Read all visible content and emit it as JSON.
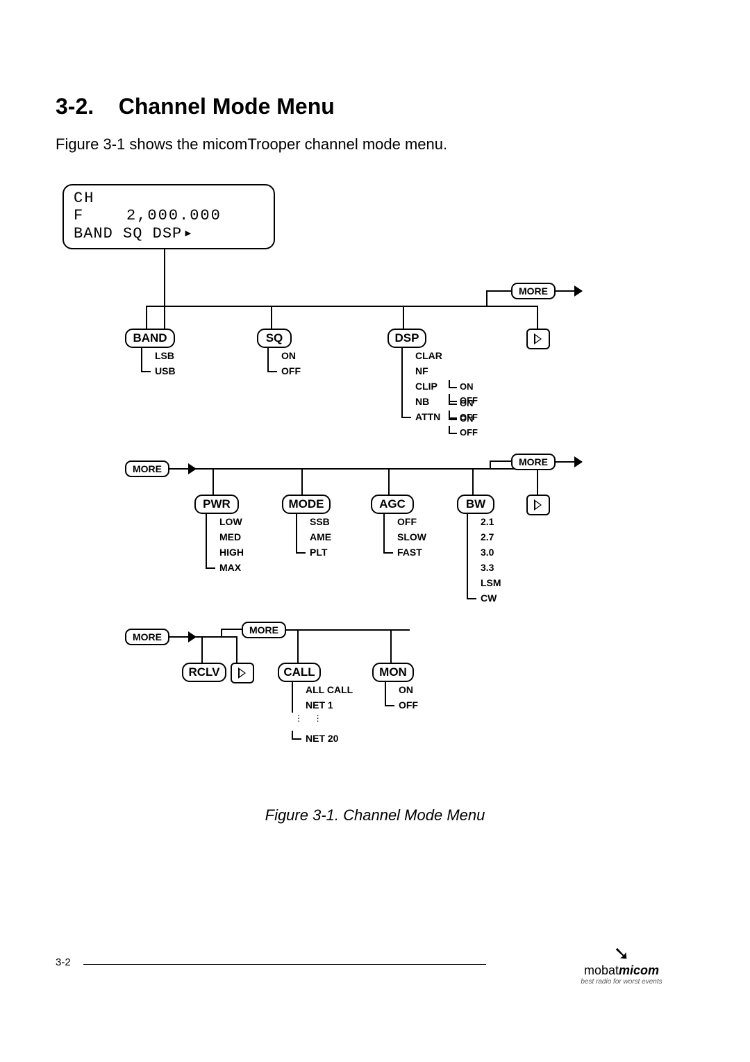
{
  "heading_num": "3-2.",
  "heading_text": "Channel Mode Menu",
  "intro": "Figure 3-1 shows the micomTrooper channel mode menu.",
  "page_number": "3-2",
  "logo": {
    "brand_left": "mobat",
    "brand_right": "micom",
    "tag": "best radio for worst events"
  },
  "caption": "Figure 3-1. Channel Mode Menu",
  "root_display": {
    "line1": "CH",
    "line2": "F    2,000.000",
    "line3": "BAND SQ  DSP"
  },
  "labels": {
    "more": "MORE",
    "band": "BAND",
    "sq": "SQ",
    "dsp": "DSP",
    "pwr": "PWR",
    "mode": "MODE",
    "agc": "AGC",
    "bw": "BW",
    "rclv": "RCLV",
    "call": "CALL",
    "mon": "MON"
  },
  "band_opts": [
    "LSB",
    "USB"
  ],
  "sq_opts": [
    "ON",
    "OFF"
  ],
  "dsp_opts": [
    "CLAR",
    "NF",
    "CLIP",
    "NB",
    "ATTN"
  ],
  "dsp_clip_opts": [
    "ON",
    "OFF"
  ],
  "dsp_nb_opts": [
    "ON",
    "OFF"
  ],
  "dsp_attn_opts": [
    "ON",
    "OFF"
  ],
  "pwr_opts": [
    "LOW",
    "MED",
    "HIGH",
    "MAX"
  ],
  "mode_opts": [
    "SSB",
    "AME",
    "PLT"
  ],
  "agc_opts": [
    "OFF",
    "SLOW",
    "FAST"
  ],
  "bw_opts": [
    "2.1",
    "2.7",
    "3.0",
    "3.3",
    "LSM",
    "CW"
  ],
  "call_opts_first": "ALL CALL",
  "call_opts_net1": "NET 1",
  "call_opts_net20": "NET 20",
  "mon_opts": [
    "ON",
    "OFF"
  ],
  "chart_data": {
    "type": "tree",
    "title": "Channel Mode Menu",
    "root": {
      "display": [
        "CH",
        "F    2,000.000",
        "BAND SQ  DSP▸"
      ],
      "children": [
        {
          "name": "BAND",
          "options": [
            "LSB",
            "USB"
          ]
        },
        {
          "name": "SQ",
          "options": [
            "ON",
            "OFF"
          ]
        },
        {
          "name": "DSP",
          "options": [
            {
              "name": "CLAR"
            },
            {
              "name": "NF"
            },
            {
              "name": "CLIP",
              "options": [
                "ON",
                "OFF"
              ]
            },
            {
              "name": "NB",
              "options": [
                "ON",
                "OFF"
              ]
            },
            {
              "name": "ATTN",
              "options": [
                "ON",
                "OFF"
              ]
            }
          ]
        },
        {
          "name": "MORE",
          "leads_to": "row2"
        }
      ]
    },
    "row2": {
      "prefix": "MORE",
      "children": [
        {
          "name": "PWR",
          "options": [
            "LOW",
            "MED",
            "HIGH",
            "MAX"
          ]
        },
        {
          "name": "MODE",
          "options": [
            "SSB",
            "AME",
            "PLT"
          ]
        },
        {
          "name": "AGC",
          "options": [
            "OFF",
            "SLOW",
            "FAST"
          ]
        },
        {
          "name": "BW",
          "options": [
            "2.1",
            "2.7",
            "3.0",
            "3.3",
            "LSM",
            "CW"
          ]
        },
        {
          "name": "MORE",
          "leads_to": "row3"
        }
      ]
    },
    "row3": {
      "prefix": "MORE",
      "children": [
        {
          "name": "RCLV"
        },
        {
          "name": "MORE",
          "children": [
            {
              "name": "CALL",
              "options": [
                "ALL CALL",
                "NET 1",
                "…",
                "NET 20"
              ]
            },
            {
              "name": "MON",
              "options": [
                "ON",
                "OFF"
              ]
            }
          ]
        }
      ]
    }
  }
}
